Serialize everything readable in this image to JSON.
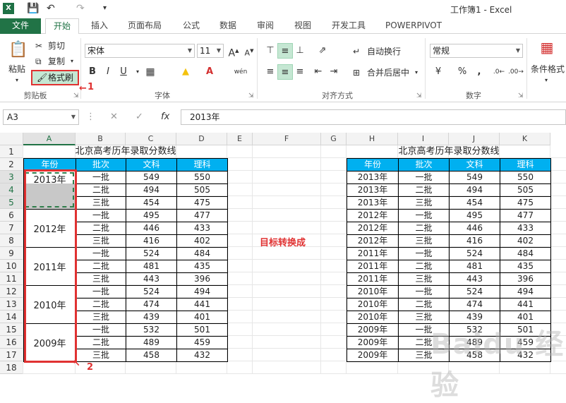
{
  "app": {
    "icon": "excel-icon",
    "window_title": "工作簿1 - Excel"
  },
  "ribbon": {
    "tabs": [
      "文件",
      "开始",
      "插入",
      "页面布局",
      "公式",
      "数据",
      "审阅",
      "视图",
      "开发工具",
      "POWERPIVOT"
    ],
    "active_tab": "开始",
    "clipboard": {
      "paste": "粘贴",
      "cut": "剪切",
      "copy": "复制",
      "format_painter": "格式刷",
      "group": "剪贴板"
    },
    "font": {
      "name": "宋体",
      "size": "11",
      "group": "字体"
    },
    "alignment": {
      "wrap": "自动换行",
      "merge": "合并后居中",
      "group": "对齐方式"
    },
    "number": {
      "format": "常规",
      "group": "数字"
    },
    "styles": {
      "conditional": "条件格式"
    },
    "callout_1": "1"
  },
  "formula_bar": {
    "name_box": "A3",
    "content": "2013年"
  },
  "columns": [
    "A",
    "B",
    "C",
    "D",
    "E",
    "F",
    "G",
    "H",
    "I",
    "J",
    "K"
  ],
  "rows": [
    "1",
    "2",
    "3",
    "4",
    "5",
    "6",
    "7",
    "8",
    "9",
    "10",
    "11",
    "12",
    "13",
    "14",
    "15",
    "16",
    "17",
    "18"
  ],
  "left_table": {
    "title": "北京高考历年录取分数线",
    "headers": [
      "年份",
      "批次",
      "文科",
      "理科"
    ],
    "years": [
      "2013年",
      "2012年",
      "2011年",
      "2010年",
      "2009年"
    ],
    "rows": [
      [
        "一批",
        "549",
        "550"
      ],
      [
        "二批",
        "494",
        "505"
      ],
      [
        "三批",
        "454",
        "475"
      ],
      [
        "一批",
        "495",
        "477"
      ],
      [
        "二批",
        "446",
        "433"
      ],
      [
        "三批",
        "416",
        "402"
      ],
      [
        "一批",
        "524",
        "484"
      ],
      [
        "二批",
        "481",
        "435"
      ],
      [
        "三批",
        "443",
        "396"
      ],
      [
        "一批",
        "524",
        "494"
      ],
      [
        "二批",
        "474",
        "441"
      ],
      [
        "三批",
        "439",
        "401"
      ],
      [
        "一批",
        "532",
        "501"
      ],
      [
        "二批",
        "489",
        "459"
      ],
      [
        "三批",
        "458",
        "432"
      ]
    ]
  },
  "middle_note": "目标转换成",
  "callout_2": "2",
  "right_table": {
    "title": "北京高考历年录取分数线",
    "headers": [
      "年份",
      "批次",
      "文科",
      "理科"
    ],
    "rows": [
      [
        "2013年",
        "一批",
        "549",
        "550"
      ],
      [
        "2013年",
        "二批",
        "494",
        "505"
      ],
      [
        "2013年",
        "三批",
        "454",
        "475"
      ],
      [
        "2012年",
        "一批",
        "495",
        "477"
      ],
      [
        "2012年",
        "二批",
        "446",
        "433"
      ],
      [
        "2012年",
        "三批",
        "416",
        "402"
      ],
      [
        "2011年",
        "一批",
        "524",
        "484"
      ],
      [
        "2011年",
        "二批",
        "481",
        "435"
      ],
      [
        "2011年",
        "三批",
        "443",
        "396"
      ],
      [
        "2010年",
        "一批",
        "524",
        "494"
      ],
      [
        "2010年",
        "二批",
        "474",
        "441"
      ],
      [
        "2010年",
        "三批",
        "439",
        "401"
      ],
      [
        "2009年",
        "一批",
        "532",
        "501"
      ],
      [
        "2009年",
        "二批",
        "489",
        "459"
      ],
      [
        "2009年",
        "三批",
        "458",
        "432"
      ]
    ]
  },
  "watermark": "Baidu 经验"
}
